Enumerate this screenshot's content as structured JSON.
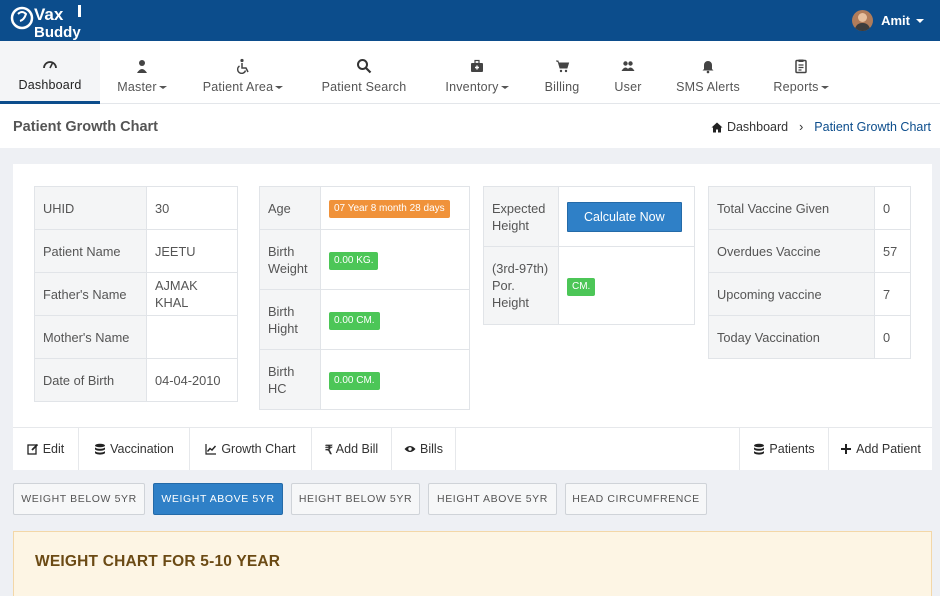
{
  "brand": {
    "line1": "Vax",
    "line2": "Buddy"
  },
  "user": {
    "name": "Amit"
  },
  "nav": {
    "dashboard": "Dashboard",
    "master": "Master",
    "patient_area": "Patient Area",
    "patient_search": "Patient Search",
    "inventory": "Inventory",
    "billing": "Billing",
    "user": "User",
    "sms_alerts": "SMS Alerts",
    "reports": "Reports"
  },
  "page": {
    "title": "Patient Growth Chart",
    "breadcrumb_home": "Dashboard",
    "breadcrumb_current": "Patient Growth Chart"
  },
  "patient": {
    "uhid_label": "UHID",
    "uhid": "30",
    "name_label": "Patient Name",
    "name": "JEETU",
    "father_label": "Father's Name",
    "father": "AJMAK KHAL",
    "mother_label": "Mother's Name",
    "mother": "",
    "dob_label": "Date of Birth",
    "dob": "04-04-2010"
  },
  "birth": {
    "age_label": "Age",
    "age": "07 Year 8 month 28 days",
    "weight_label": "Birth Weight",
    "weight": "0.00 KG.",
    "height_label": "Birth Hight",
    "height": "0.00 CM.",
    "hc_label": "Birth HC",
    "hc": "0.00 CM."
  },
  "expected": {
    "height_label": "Expected Height",
    "calc_button": "Calculate Now",
    "por_label": "(3rd-97th) Por. Height",
    "por_value": "CM."
  },
  "vaccine": {
    "total_label": "Total Vaccine Given",
    "total": "0",
    "overdue_label": "Overdues Vaccine",
    "overdue": "57",
    "upcoming_label": "Upcoming vaccine",
    "upcoming": "7",
    "today_label": "Today Vaccination",
    "today": "0"
  },
  "actions": {
    "edit": "Edit",
    "vaccination": "Vaccination",
    "growth_chart": "Growth Chart",
    "add_bill": "Add Bill",
    "bills": "Bills",
    "patients": "Patients",
    "add_patient": "Add Patient"
  },
  "chart_tabs": {
    "weight_below": "WEIGHT BELOW 5YR",
    "weight_above": "WEIGHT ABOVE 5YR",
    "height_below": "HEIGHT BELOW 5YR",
    "height_above": "HEIGHT ABOVE 5YR",
    "head_circ": "HEAD CIRCUMFRENCE"
  },
  "chart_panel": {
    "title": "WEIGHT CHART FOR 5-10 YEAR"
  },
  "colors": {
    "primary": "#0c4d8c",
    "button": "#2f80c7",
    "orange": "#f0923a",
    "green": "#4cc657"
  }
}
